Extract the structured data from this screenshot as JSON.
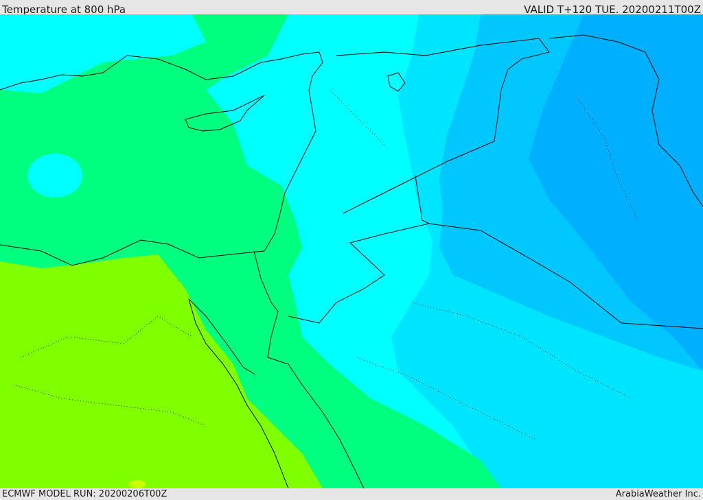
{
  "header": {
    "title": "Temperature at 800 hPa",
    "valid": "VALID T+120 TUE. 20200211T00Z"
  },
  "footer": {
    "model_run": "ECMWF MODEL RUN: 20200206T00Z",
    "credit": "ArabiaWeather Inc."
  },
  "colors": {
    "yellow_green": "#7fff00",
    "green": "#00ff7f",
    "cyan": "#00ffff",
    "light_blue": "#00e5ff",
    "blue": "#00c8ff",
    "deep_blue": "#00b0ff",
    "border": "#000000"
  }
}
